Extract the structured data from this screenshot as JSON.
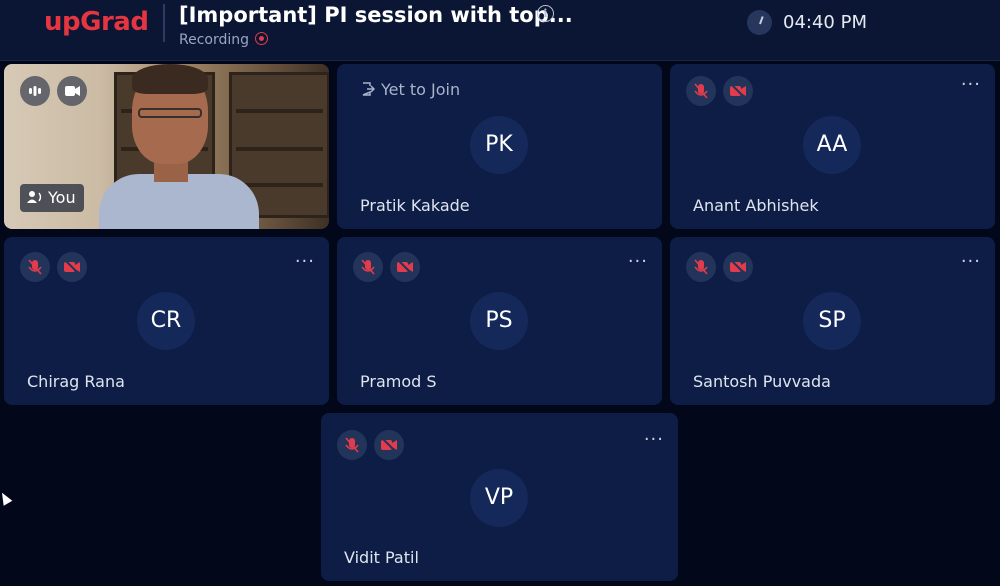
{
  "header": {
    "logo": "upGrad",
    "title": "[Important] PI session with top...",
    "recording_label": "Recording",
    "time": "04:40 PM"
  },
  "self_tile": {
    "label": "You"
  },
  "participants": [
    {
      "initials": "PK",
      "name": "Pratik Kakade",
      "status": "Yet to Join"
    },
    {
      "initials": "AA",
      "name": "Anant Abhishek"
    },
    {
      "initials": "CR",
      "name": "Chirag Rana"
    },
    {
      "initials": "PS",
      "name": "Pramod S"
    },
    {
      "initials": "SP",
      "name": "Santosh Puvvada"
    },
    {
      "initials": "VP",
      "name": "Vidit Patil"
    }
  ],
  "more_label": "···",
  "colors": {
    "background": "#02081a",
    "header": "#0a1633",
    "tile": "#0d1d45",
    "brand": "#e53540",
    "muted_icon": "#e23c4c"
  }
}
